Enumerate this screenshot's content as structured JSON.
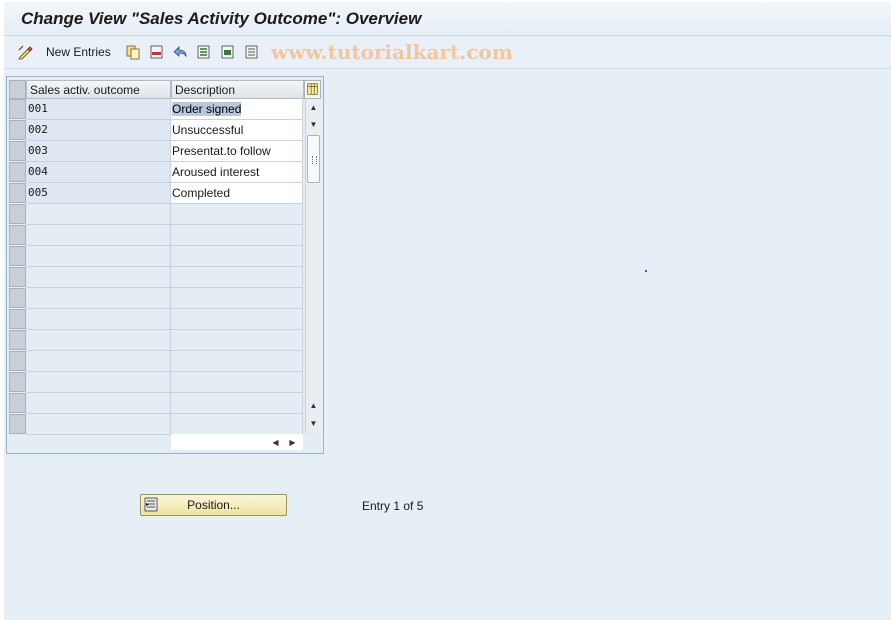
{
  "title": "Change View \"Sales Activity Outcome\": Overview",
  "toolbar": {
    "new_entries_label": "New Entries",
    "watermark": "www.tutorialkart.com",
    "icons": [
      "change-display-icon",
      "copy-icon",
      "delete-icon",
      "undo-icon",
      "select-all-icon",
      "select-block-icon",
      "deselect-all-icon"
    ]
  },
  "table": {
    "headers": [
      "Sales activ. outcome",
      "Description"
    ],
    "rows": [
      {
        "key": "001",
        "desc": "Order signed"
      },
      {
        "key": "002",
        "desc": "Unsuccessful"
      },
      {
        "key": "003",
        "desc": "Presentat.to follow"
      },
      {
        "key": "004",
        "desc": "Aroused interest"
      },
      {
        "key": "005",
        "desc": "Completed"
      }
    ],
    "empty_rows": 11
  },
  "position_button": "Position...",
  "entry_info": "Entry 1 of 5"
}
